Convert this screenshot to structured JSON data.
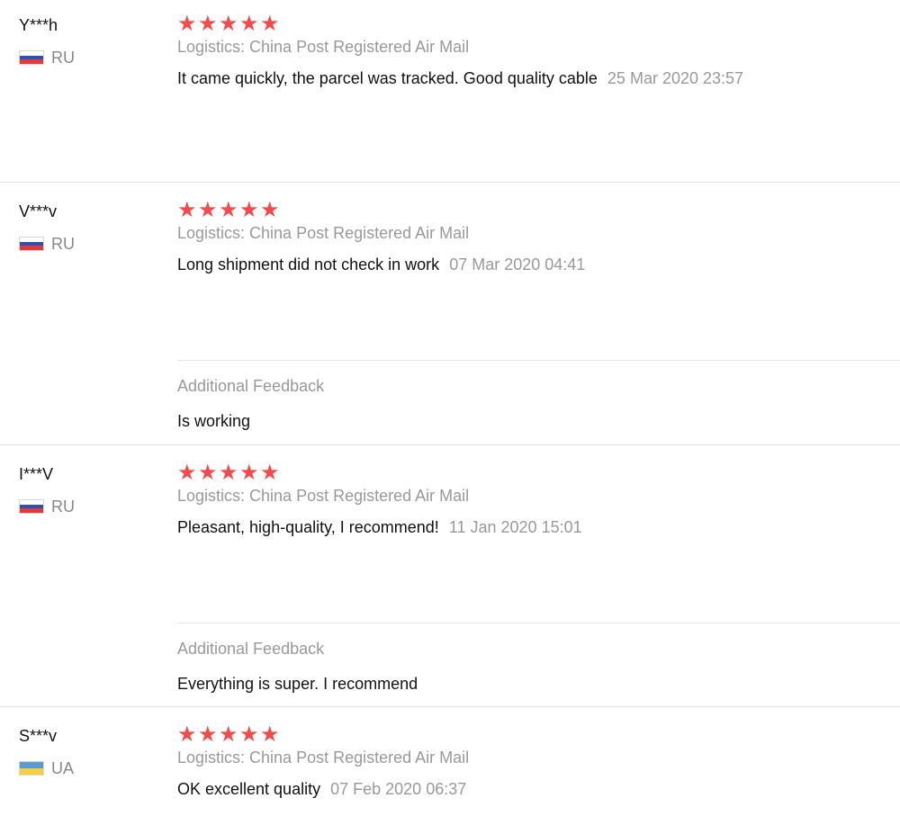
{
  "reviews": [
    {
      "buyer": "Y***h",
      "country": "RU",
      "flag": "russia-flag",
      "rating": 5,
      "stars": [
        "★",
        "★",
        "★",
        "★",
        "★"
      ],
      "logistics": "Logistics: China Post Registered Air Mail",
      "feedback": "It came quickly, the parcel was tracked. Good quality cable",
      "date": "25 Mar 2020 23:57"
    },
    {
      "buyer": "V***v",
      "country": "RU",
      "flag": "russia-flag",
      "rating": 5,
      "stars": [
        "★",
        "★",
        "★",
        "★",
        "★"
      ],
      "logistics": "Logistics: China Post Registered Air Mail",
      "feedback": "Long shipment did not check in work",
      "date": "07 Mar 2020 04:41",
      "additional_title": "Additional Feedback",
      "additional_text": "Is working"
    },
    {
      "buyer": "I***V",
      "country": "RU",
      "flag": "russia-flag",
      "rating": 5,
      "stars": [
        "★",
        "★",
        "★",
        "★",
        "★"
      ],
      "logistics": "Logistics: China Post Registered Air Mail",
      "feedback": "Pleasant, high-quality, I recommend!",
      "date": "11 Jan 2020 15:01",
      "additional_title": "Additional Feedback",
      "additional_text": "Everything is super. I recommend"
    },
    {
      "buyer": "S***v",
      "country": "UA",
      "flag": "ukraine-flag",
      "rating": 5,
      "stars": [
        "★",
        "★",
        "★",
        "★",
        "★"
      ],
      "logistics": "Logistics: China Post Registered Air Mail",
      "feedback": "OK excellent quality",
      "date": "07 Feb 2020 06:37"
    }
  ],
  "colors": {
    "star": "#f24b4b",
    "muted_text": "#999999",
    "divider": "#e3e3e3"
  }
}
